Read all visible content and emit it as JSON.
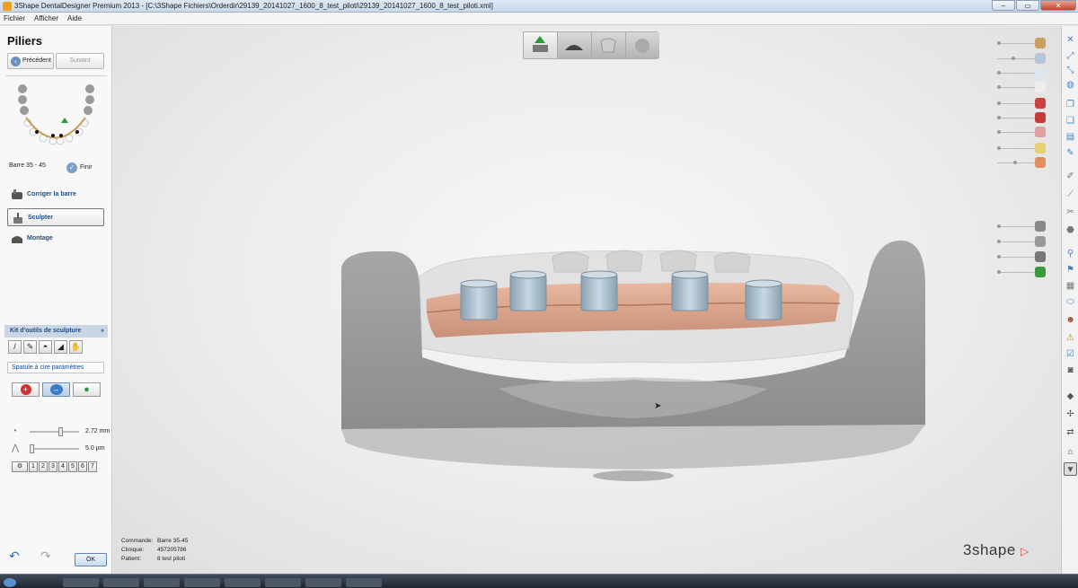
{
  "window": {
    "title": "3Shape DentalDesigner Premium 2013 - [C:\\3Shape Fichiers\\Orderdir\\29139_20141027_1600_8_test_piloti\\29139_20141027_1600_8_test_piloti.xml]"
  },
  "menu": [
    "Fichier",
    "Afficher",
    "Aide"
  ],
  "left": {
    "title": "Piliers",
    "prev_label": "Précédent",
    "next_label": "Suivant",
    "step_label": "Barre 35 - 45",
    "finish_label": "Finir",
    "tools": [
      {
        "label": "Corriger la barre",
        "icon": "bar-tool-icon"
      },
      {
        "label": "Sculpter",
        "icon": "sculpt-tool-icon"
      },
      {
        "label": "Montage",
        "icon": "setup-tool-icon"
      }
    ],
    "kit_title": "Kit d'outils de sculpture",
    "spatula_title": "Spatule à cire paramètres",
    "size_value": "2.72 mm",
    "step_value": "5.0 µm",
    "numbers": [
      "1",
      "2",
      "3",
      "4",
      "5",
      "6",
      "7"
    ],
    "ok_label": "OK"
  },
  "info": {
    "order_label": "Commande:",
    "order_value": "Barre 35-45",
    "clinic_label": "Clinique:",
    "clinic_value": "457205786",
    "patient_label": "Patient:",
    "patient_value": "8 test piloti"
  },
  "brand": {
    "logo": "3shape",
    "accent": "#c8503c"
  },
  "colors": {
    "accent": "#1f4d86",
    "bar": "#d9a58c",
    "gum": "#9a9a9a"
  }
}
